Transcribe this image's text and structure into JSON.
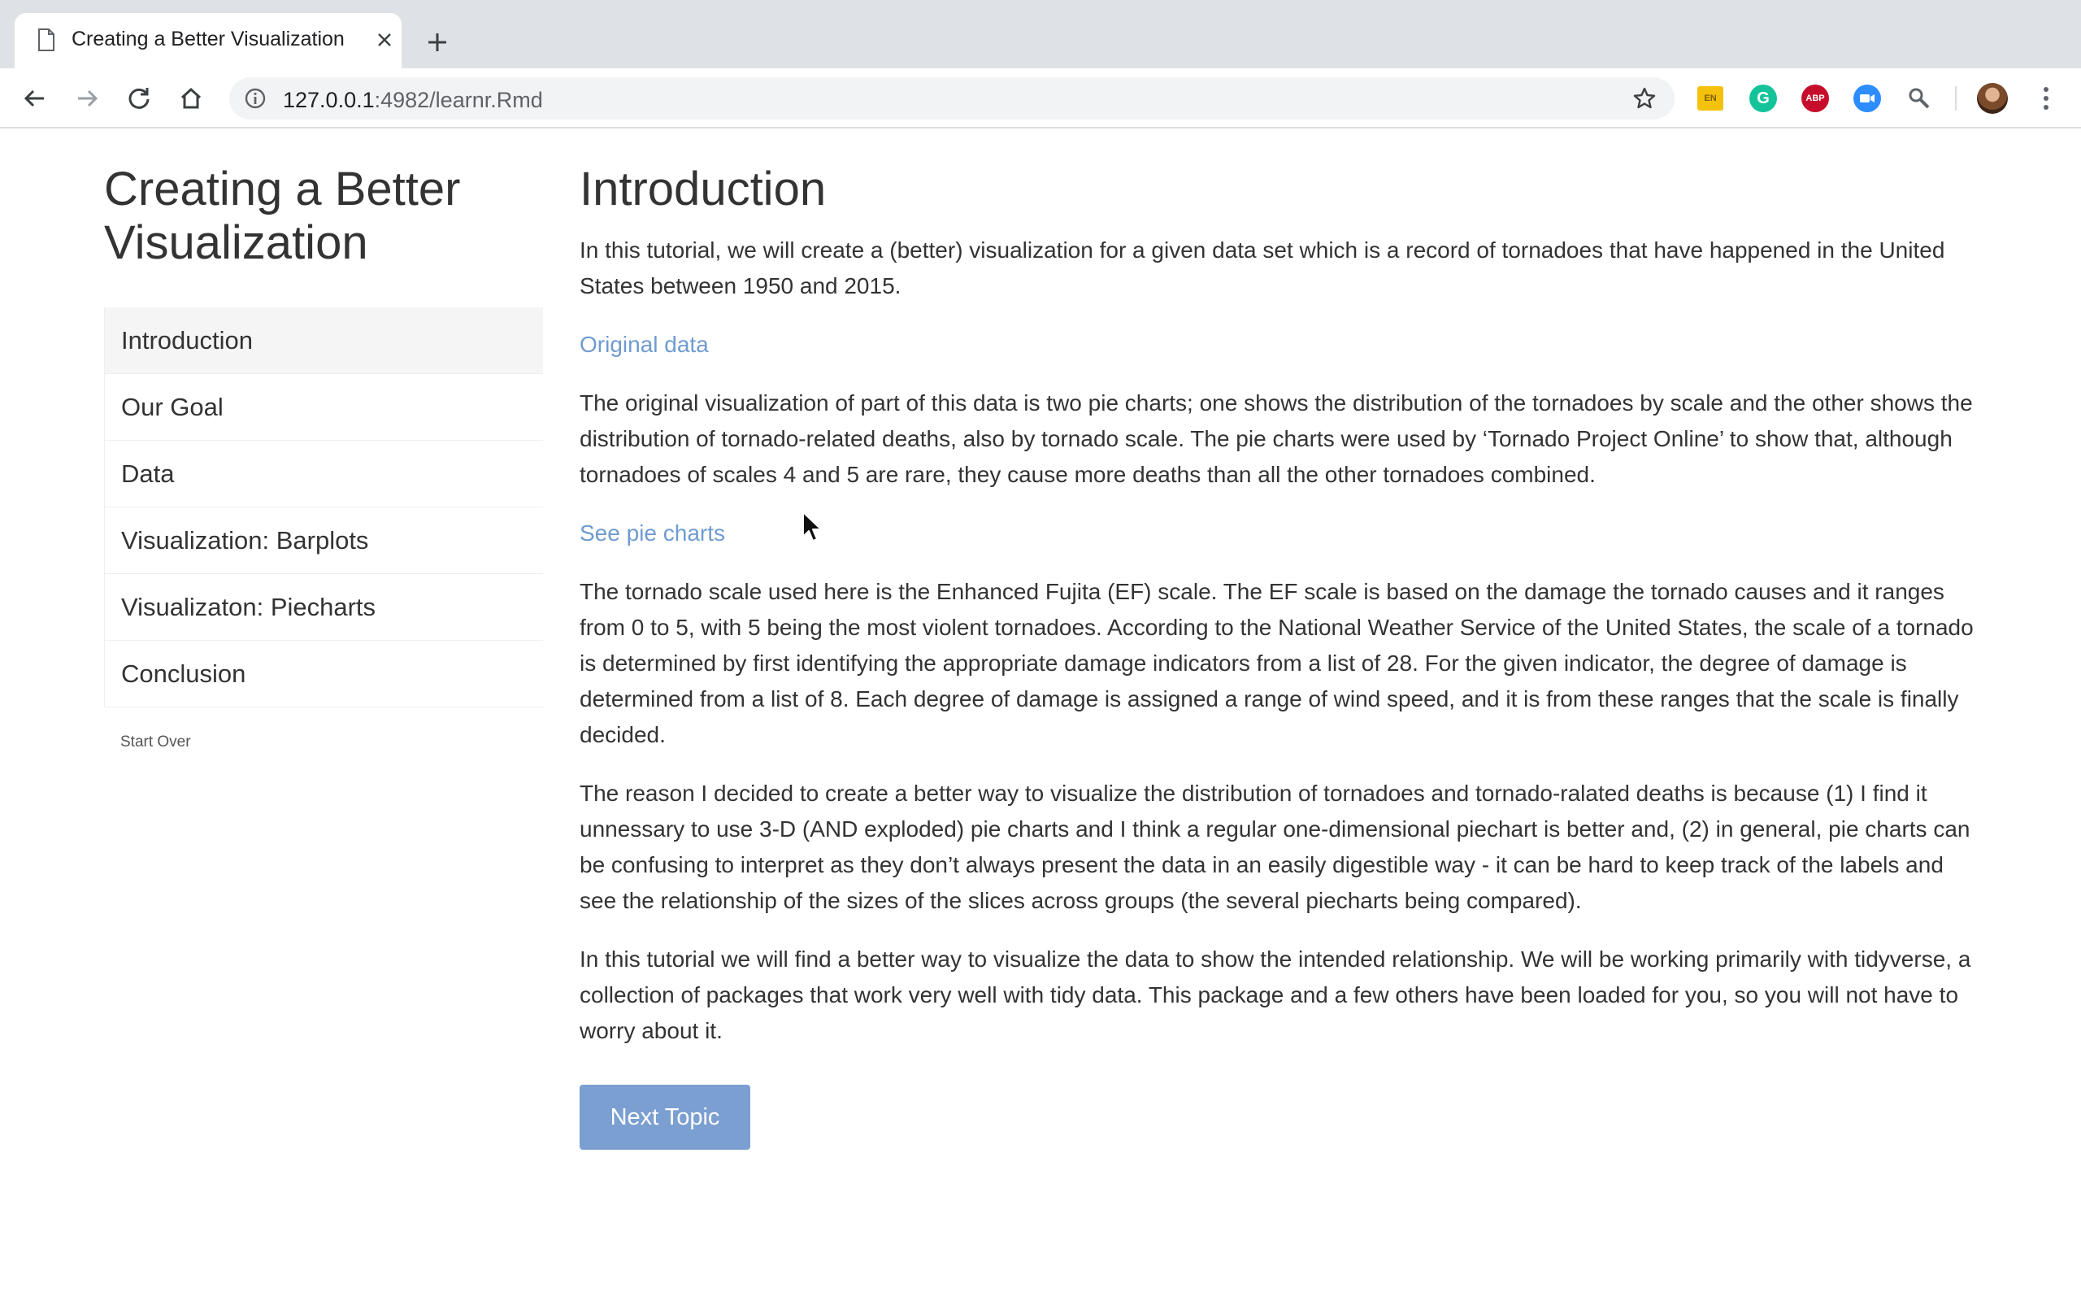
{
  "browser": {
    "tab_title": "Creating a Better Visualization",
    "url_host": "127.0.0.1",
    "url_rest": ":4982/learnr.Rmd",
    "extensions": [
      {
        "name": "google-translate-icon",
        "label": "EN",
        "color": "#f4c20d"
      },
      {
        "name": "grammarly-icon",
        "label": "G",
        "color": "#15c39a"
      },
      {
        "name": "adblock-plus-icon",
        "label": "ABP",
        "color": "#c70d2c"
      },
      {
        "name": "zoom-icon",
        "label": "",
        "color": "#2d8cff"
      },
      {
        "name": "extension-puzzle-icon",
        "label": "",
        "color": "#5f6368"
      }
    ]
  },
  "sidebar": {
    "title": "Creating a Better Visualization",
    "items": [
      {
        "label": "Introduction",
        "active": true
      },
      {
        "label": "Our Goal",
        "active": false
      },
      {
        "label": "Data",
        "active": false
      },
      {
        "label": "Visualization: Barplots",
        "active": false
      },
      {
        "label": "Visualizaton: Piecharts",
        "active": false
      },
      {
        "label": "Conclusion",
        "active": false
      }
    ],
    "start_over": "Start Over"
  },
  "main": {
    "title": "Introduction",
    "para1": "In this tutorial, we will create a (better) visualization for a given data set which is a record of tornadoes that have happened in the United States between 1950 and 2015.",
    "link_original": "Original data",
    "para2": "The original visualization of part of this data is two pie charts; one shows the distribution of the tornadoes by scale and the other shows the distribution of tornado-related deaths, also by tornado scale. The pie charts were used by ‘Tornado Project Online’ to show that, although tornadoes of scales 4 and 5 are rare, they cause more deaths than all the other tornadoes combined.",
    "link_pie": "See pie charts",
    "para3": "The tornado scale used here is the Enhanced Fujita (EF) scale. The EF scale is based on the damage the tornado causes and it ranges from 0 to 5, with 5 being the most violent tornadoes. According to the National Weather Service of the United States, the scale of a tornado is determined by first identifying the appropriate damage indicators from a list of 28. For the given indicator, the degree of damage is determined from a list of 8. Each degree of damage is assigned a range of wind speed, and it is from these ranges that the scale is finally decided.",
    "para4": "The reason I decided to create a better way to visualize the distribution of tornadoes and tornado-ralated deaths is because (1) I find it unnessary to use 3-D (AND exploded) pie charts and I think a regular one-dimensional piechart is better and, (2) in general, pie charts can be confusing to interpret as they don’t always present the data in an easily digestible way - it can be hard to keep track of the labels and see the relationship of the sizes of the slices across groups (the several piecharts being compared).",
    "para5": "In this tutorial we will find a better way to visualize the data to show the intended relationship. We will be working primarily with tidyverse, a collection of packages that work very well with tidy data. This package and a few others have been loaded for you, so you will not have to worry about it.",
    "next_button": "Next Topic"
  },
  "colors": {
    "link": "#6f9bd1",
    "button": "#7b9fd0",
    "active_nav_bg": "#f5f5f5"
  }
}
